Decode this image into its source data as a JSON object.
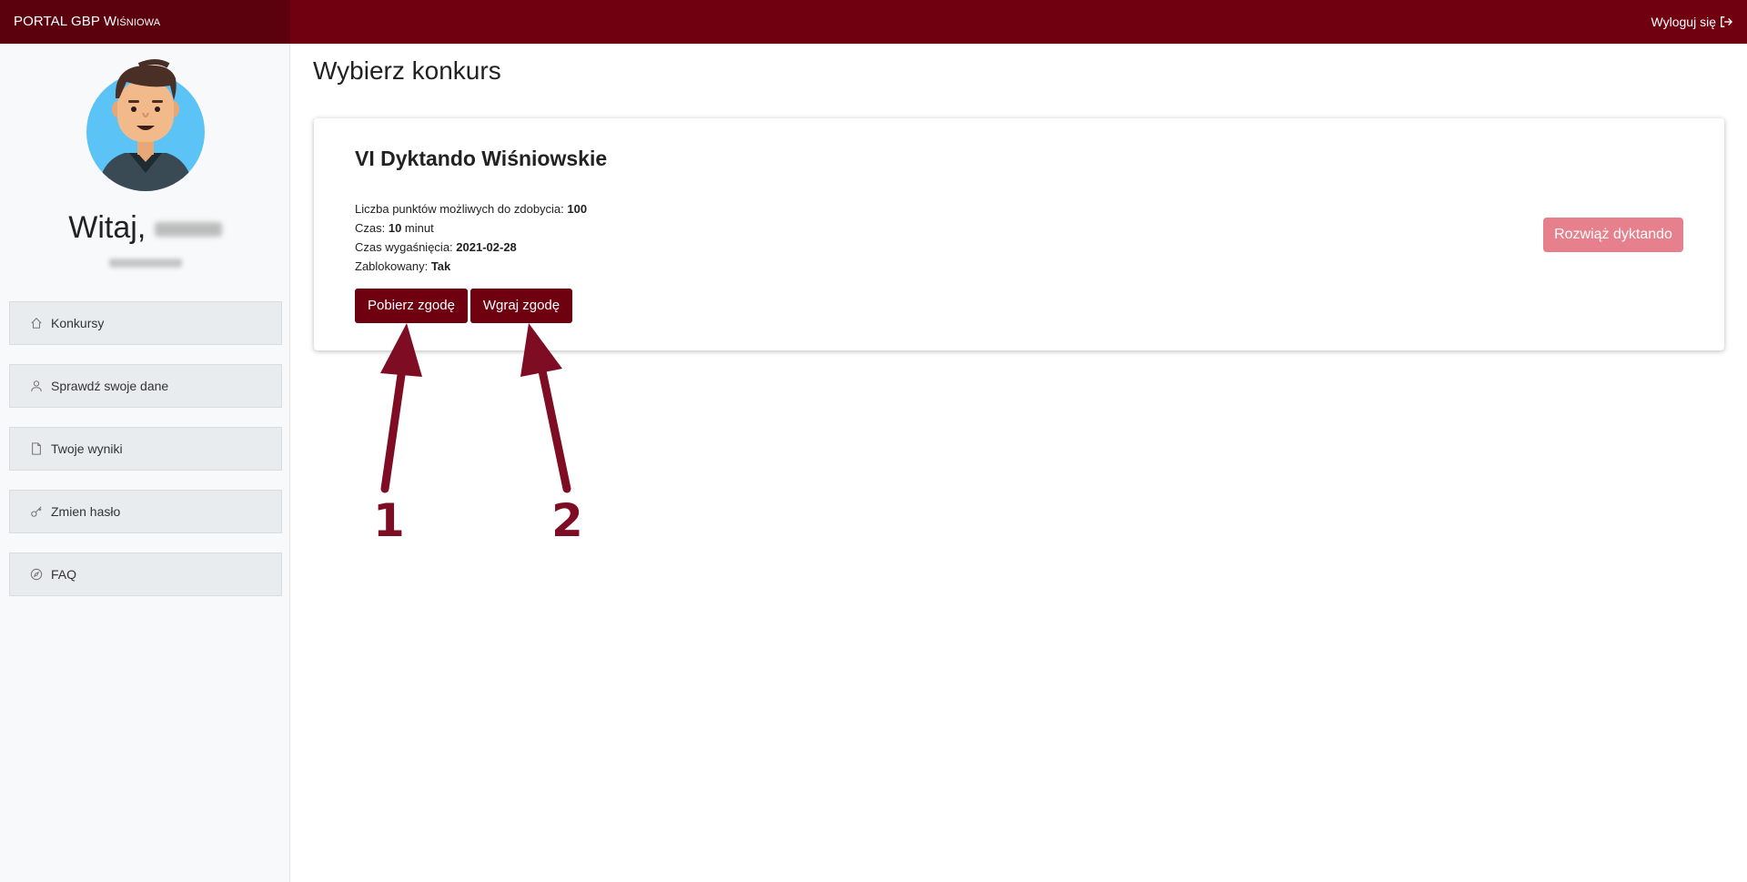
{
  "header": {
    "brand_prefix": "PORTAL GBP ",
    "brand_name": "Wiśniowa",
    "logout_label": "Wyloguj się"
  },
  "sidebar": {
    "greeting": "Witaj,",
    "items": [
      {
        "label": "Konkursy",
        "icon": "home-icon"
      },
      {
        "label": "Sprawdź swoje dane",
        "icon": "user-icon"
      },
      {
        "label": "Twoje wyniki",
        "icon": "file-icon"
      },
      {
        "label": "Zmien hasło",
        "icon": "key-icon"
      },
      {
        "label": "FAQ",
        "icon": "compass-icon"
      }
    ]
  },
  "main": {
    "title": "Wybierz konkurs",
    "contest": {
      "title": "VI Dyktando Wiśniowskie",
      "points_label": "Liczba punktów możliwych do zdobycia: ",
      "points_value": "100",
      "time_label": "Czas: ",
      "time_value": "10",
      "time_unit": " minut",
      "expiry_label": "Czas wygaśnięcia: ",
      "expiry_value": "2021-02-28",
      "locked_label": "Zablokowany: ",
      "locked_value": "Tak",
      "download_button": "Pobierz zgodę",
      "upload_button": "Wgraj zgodę",
      "solve_button": "Rozwiąż dyktando"
    }
  },
  "annotations": {
    "label_1": "1",
    "label_2": "2",
    "color": "#7e0c22"
  },
  "colors": {
    "topbar": "#700010",
    "brand_bg": "#5b000d",
    "primary_button": "#6e0010",
    "disabled_button": "#e6808c"
  }
}
